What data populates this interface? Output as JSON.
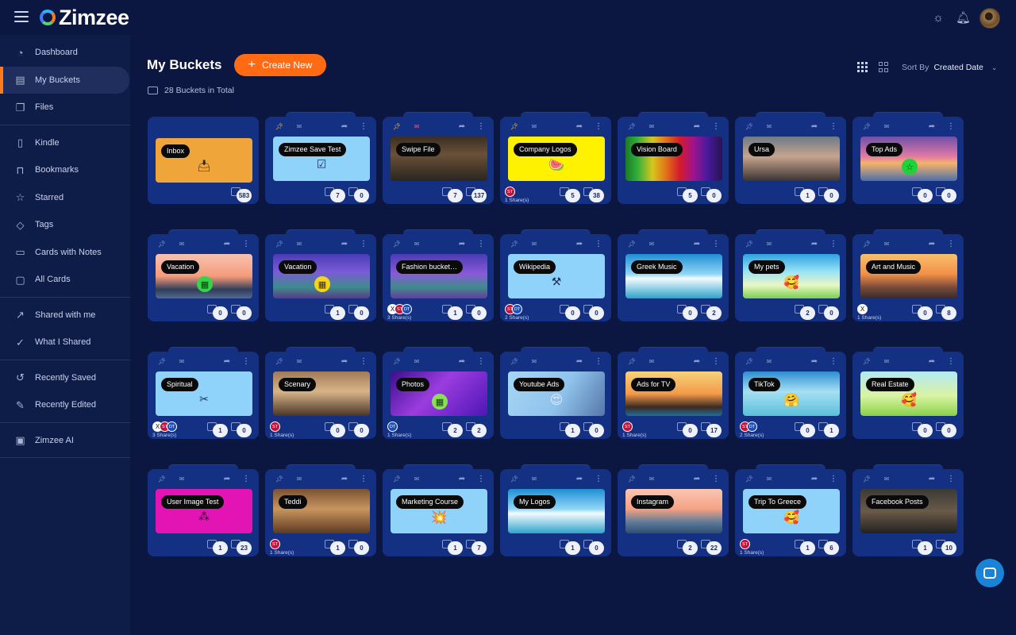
{
  "app": {
    "name": "Zimzee"
  },
  "header": {
    "icons": [
      "menu-icon",
      "sun-icon",
      "bell-icon",
      "avatar"
    ]
  },
  "sidebar": {
    "groups": [
      [
        {
          "label": "Dashboard",
          "icon": "dashboard-icon"
        },
        {
          "label": "My Buckets",
          "icon": "bucket-icon",
          "active": true
        },
        {
          "label": "Files",
          "icon": "files-icon"
        }
      ],
      [
        {
          "label": "Kindle",
          "icon": "kindle-icon"
        },
        {
          "label": "Bookmarks",
          "icon": "bookmark-icon"
        },
        {
          "label": "Starred",
          "icon": "star-icon"
        },
        {
          "label": "Tags",
          "icon": "tag-icon"
        },
        {
          "label": "Cards with Notes",
          "icon": "notes-icon"
        },
        {
          "label": "All Cards",
          "icon": "cards-icon"
        }
      ],
      [
        {
          "label": "Shared with me",
          "icon": "shared-in-icon"
        },
        {
          "label": "What I Shared",
          "icon": "shared-out-icon"
        }
      ],
      [
        {
          "label": "Recently Saved",
          "icon": "history-icon"
        },
        {
          "label": "Recently Edited",
          "icon": "edit-icon"
        }
      ],
      [
        {
          "label": "Zimzee AI",
          "icon": "ai-icon"
        }
      ]
    ]
  },
  "main": {
    "title": "My Buckets",
    "create_label": "Create New",
    "total_label": "28 Buckets in Total",
    "sort_label": "Sort By",
    "sort_value": "Created Date"
  },
  "buckets": [
    {
      "name": "Inbox",
      "files": "583",
      "plain": true,
      "thumb": "inbox",
      "bg": "#f0a53a"
    },
    {
      "name": "Zimzee Save Test",
      "files": "7",
      "cards": "0",
      "pin": true,
      "thumb": "calendar",
      "bg": "#8fd3fb"
    },
    {
      "name": "Swipe File",
      "files": "7",
      "cards": "137",
      "pin": true,
      "mail": true,
      "thumb": "photo-men",
      "bg": "#5a4632"
    },
    {
      "name": "Company Logos",
      "files": "5",
      "cards": "38",
      "pin": true,
      "thumb": "watermelon",
      "bg": "#fff200",
      "shares": "1 Share(s)",
      "avatars": [
        "ST"
      ]
    },
    {
      "name": "Vision Board",
      "files": "5",
      "cards": "0",
      "thumb": "rainbow",
      "bg": "#333"
    },
    {
      "name": "Ursa",
      "files": "1",
      "cards": "0",
      "thumb": "photo-woman",
      "bg": "#8a8680"
    },
    {
      "name": "Top Ads",
      "files": "0",
      "cards": "0",
      "thumb": "sunset-star",
      "bg": "#c76aa0"
    },
    {
      "name": "Vacation",
      "files": "0",
      "cards": "0",
      "thumb": "sunset-film",
      "bg": "#f2a07b"
    },
    {
      "name": "Vacation",
      "files": "1",
      "cards": "0",
      "thumb": "cartoon-film",
      "bg": "#5b4fb0"
    },
    {
      "name": "Fashion bucket…",
      "files": "1",
      "cards": "0",
      "thumb": "cartoon",
      "bg": "#6a4fb0",
      "shares": "3 Share(s)",
      "avatars": [
        "X",
        "ST",
        "DT"
      ]
    },
    {
      "name": "Wikipedia",
      "files": "0",
      "cards": "0",
      "thumb": "hammer",
      "bg": "#8fd3fb",
      "shares": "2 Share(s)",
      "avatars": [
        "ST",
        "DT"
      ]
    },
    {
      "name": "Greek Music",
      "files": "0",
      "cards": "2",
      "thumb": "ship",
      "bg": "#2e9ad8"
    },
    {
      "name": "My pets",
      "files": "2",
      "cards": "0",
      "thumb": "beach-emoji",
      "bg": "#7fd0e8"
    },
    {
      "name": "Art and Music",
      "files": "0",
      "cards": "8",
      "thumb": "palms",
      "bg": "#f39a4a",
      "shares": "1 Share(s)",
      "avatars": [
        "X"
      ]
    },
    {
      "name": "Spiritual",
      "files": "1",
      "cards": "0",
      "thumb": "scissors",
      "bg": "#8fd3fb",
      "shares": "3 Share(s)",
      "avatars": [
        "X",
        "ST",
        "DT"
      ]
    },
    {
      "name": "Scenary",
      "files": "0",
      "cards": "0",
      "thumb": "dog",
      "bg": "#8a6a4c",
      "shares": "1 Share(s)",
      "avatars": [
        "ST"
      ]
    },
    {
      "name": "Photos",
      "files": "2",
      "cards": "2",
      "thumb": "galaxy-film",
      "bg": "#6c2bd9",
      "shares": "1 Share(s)",
      "avatars": [
        "DT"
      ]
    },
    {
      "name": "Youtube Ads",
      "files": "1",
      "cards": "0",
      "thumb": "blobs",
      "bg": "#8fc3ec"
    },
    {
      "name": "Ads for TV",
      "files": "0",
      "cards": "17",
      "thumb": "palms-sunset",
      "bg": "#f39a4a",
      "shares": "1 Share(s)",
      "avatars": [
        "ST"
      ]
    },
    {
      "name": "TikTok",
      "files": "0",
      "cards": "1",
      "thumb": "sea-emoji",
      "bg": "#59b5d8",
      "shares": "2 Share(s)",
      "avatars": [
        "ST",
        "DT"
      ]
    },
    {
      "name": "Real Estate",
      "files": "0",
      "cards": "0",
      "thumb": "green-emoji",
      "bg": "#b7e36c"
    },
    {
      "name": "User Image Test",
      "files": "1",
      "cards": "23",
      "thumb": "wand",
      "bg": "#e314b4"
    },
    {
      "name": "Teddi",
      "files": "1",
      "cards": "0",
      "thumb": "dog2",
      "bg": "#a0703f",
      "shares": "1 Share(s)",
      "avatars": [
        "ST"
      ]
    },
    {
      "name": "Marketing Course",
      "files": "1",
      "cards": "7",
      "thumb": "burst",
      "bg": "#8fd3fb"
    },
    {
      "name": "My Logos",
      "files": "1",
      "cards": "0",
      "thumb": "ship2",
      "bg": "#2e9ad8"
    },
    {
      "name": "Instagram",
      "files": "2",
      "cards": "22",
      "thumb": "sail",
      "bg": "#f2a07b"
    },
    {
      "name": "Trip To Greece",
      "files": "1",
      "cards": "6",
      "thumb": "emoji",
      "bg": "#8fd3fb",
      "shares": "1 Share(s)",
      "avatars": [
        "ST"
      ]
    },
    {
      "name": "Facebook Posts",
      "files": "1",
      "cards": "10",
      "thumb": "car",
      "bg": "#3b3a36"
    }
  ]
}
